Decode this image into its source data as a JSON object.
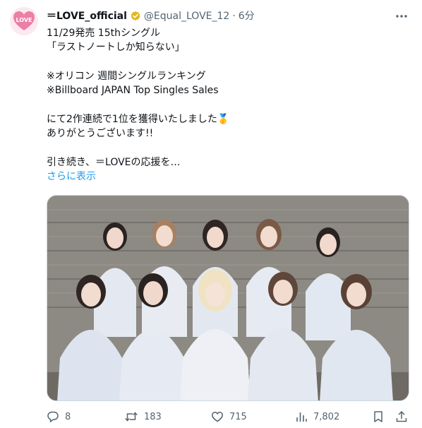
{
  "author": {
    "display_name": "＝LOVE_official",
    "handle": "@Equal_LOVE_12",
    "separator": "·",
    "time": "6分",
    "avatar_text": "LOVE"
  },
  "tweet": {
    "lines": [
      "11/29発売 15thシングル",
      "「ラストノートしか知らない」",
      "",
      "※オリコン 週間シングルランキング",
      "※Billboard JAPAN Top Singles Sales",
      "",
      "にて2作連続で1位を獲得いたしました🥇",
      "ありがとうございます!!",
      "",
      "引き続き、＝LOVEの応援を…"
    ],
    "show_more": "さらに表示"
  },
  "metrics": {
    "replies": "8",
    "retweets": "183",
    "likes": "715",
    "views": "7,802"
  },
  "colors": {
    "accent": "#1d9bf0",
    "text": "#0f1419",
    "muted": "#536471",
    "verified": "#e2b719"
  }
}
